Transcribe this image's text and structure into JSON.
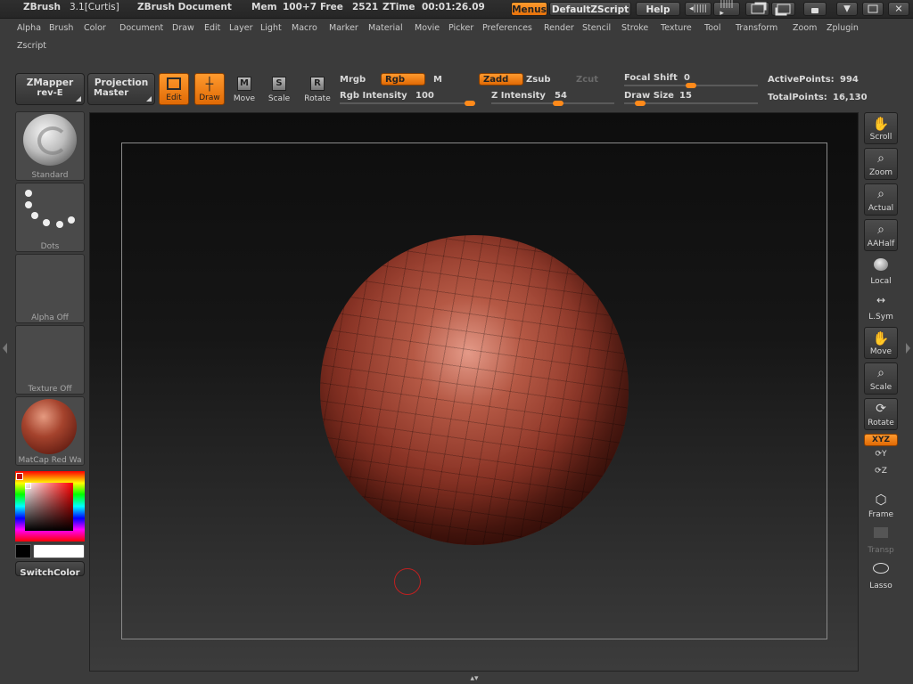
{
  "titlebar": {
    "app": "ZBrush",
    "version": "3.1[Curtis]",
    "document": "ZBrush Document",
    "mem_label": "Mem",
    "mem_value": "100+7",
    "free_label": "Free",
    "free_value": "2521",
    "ztime_label": "ZTime",
    "ztime_value": "00:01:26.09",
    "menus_btn": "Menus",
    "script_btn": "DefaultZScript",
    "help_btn": "Help"
  },
  "menubar": [
    "Alpha",
    "Brush",
    "Color",
    "Document",
    "Draw",
    "Edit",
    "Layer",
    "Light",
    "Macro",
    "Marker",
    "Material",
    "Movie",
    "Picker",
    "Preferences",
    "Render",
    "Stencil",
    "Stroke",
    "Texture",
    "Tool",
    "Transform",
    "Zoom",
    "Zplugin"
  ],
  "menubar2": [
    "Zscript"
  ],
  "toolbar": {
    "zmapper_l1": "ZMapper",
    "zmapper_l2": "rev-E",
    "projection_l1": "Projection",
    "projection_l2": "Master",
    "edit": "Edit",
    "draw": "Draw",
    "move": "Move",
    "scale": "Scale",
    "rotate": "Rotate",
    "move_key": "M",
    "scale_key": "S",
    "rotate_key": "R",
    "mrgb": "Mrgb",
    "rgb": "Rgb",
    "m": "M",
    "zadd": "Zadd",
    "zsub": "Zsub",
    "zcut": "Zcut",
    "rgb_intensity_label": "Rgb Intensity",
    "rgb_intensity": "100",
    "z_intensity_label": "Z Intensity",
    "z_intensity": "54",
    "focal_shift_label": "Focal Shift",
    "focal_shift": "0",
    "draw_size_label": "Draw Size",
    "draw_size": "15",
    "active_points_label": "ActivePoints:",
    "active_points": "994",
    "total_points_label": "TotalPoints:",
    "total_points": "16,130"
  },
  "sliders": {
    "rgb_intensity_frac": 1.0,
    "z_intensity_frac": 0.54,
    "focal_shift_frac": 0.5,
    "draw_size_frac": 0.12
  },
  "left_panel": {
    "brush": "Standard",
    "stroke": "Dots",
    "alpha": "Alpha Off",
    "texture": "Texture Off",
    "material": "MatCap Red Wa",
    "switch_color": "SwitchColor"
  },
  "right_panel": [
    "Scroll",
    "Zoom",
    "Actual",
    "AAHalf",
    "Local",
    "L.Sym",
    "Move",
    "Scale",
    "Rotate",
    "XYZ",
    "Y",
    "Z",
    "Frame",
    "Transp",
    "Lasso"
  ],
  "colors": {
    "accent": "#f07c12",
    "panel": "#3b3b3b",
    "sphere": "#8a3a2c"
  }
}
